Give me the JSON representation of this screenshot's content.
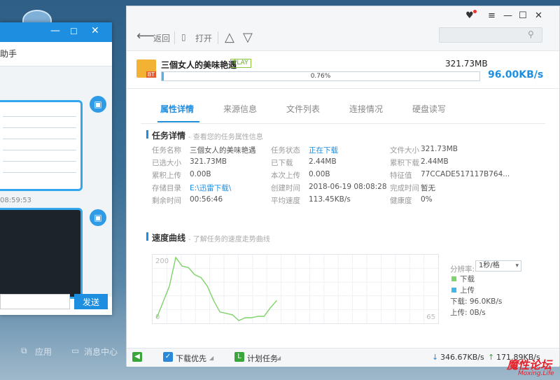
{
  "desktop": {
    "chat_title_fragment": "助手",
    "chat_time": "08:59:53",
    "send_label": "发送",
    "bottom_apps": "应用",
    "bottom_msg": "消息中心"
  },
  "window_controls": {
    "skin": "♥",
    "menu": "≡",
    "minimize": "—",
    "maximize": "☐",
    "close": "✕"
  },
  "toolbar": {
    "back_label": "返回",
    "open_label": "打开",
    "search_placeholder": ""
  },
  "task": {
    "name": "三個女人的美味艳遇",
    "play_label": "PLAY",
    "badge": "BT",
    "size": "321.73MB",
    "progress_percent": 0.76,
    "progress_text": "0.76%",
    "speed": "96.00KB/s"
  },
  "tabs": [
    "属性详情",
    "来源信息",
    "文件列表",
    "连接情况",
    "硬盘读写"
  ],
  "task_info": {
    "title": "任务详情",
    "subtitle": "- 查看您的任务属性信息",
    "rows": [
      [
        [
          "任务名称",
          "三個女人的美味艳遇",
          false
        ],
        [
          "任务状态",
          "正在下载",
          true
        ],
        [
          "文件大小",
          "321.73MB",
          false
        ]
      ],
      [
        [
          "已选大小",
          "321.73MB",
          false
        ],
        [
          "已下载",
          "2.44MB",
          false
        ],
        [
          "累积下载",
          "2.44MB",
          false
        ]
      ],
      [
        [
          "累积上传",
          "0.00B",
          false
        ],
        [
          "本次上传",
          "0.00B",
          false
        ],
        [
          "特征值",
          "77CCADE517117B764...",
          false
        ]
      ],
      [
        [
          "存储目录",
          "E:\\迅雷下载\\",
          true
        ],
        [
          "创建时间",
          "2018-06-19 08:08:28",
          false
        ],
        [
          "完成时间",
          "暂无",
          false
        ]
      ],
      [
        [
          "剩余时间",
          "00:56:46",
          false
        ],
        [
          "平均速度",
          "113.45KB/s",
          false
        ],
        [
          "健康度",
          "0%",
          false
        ]
      ]
    ]
  },
  "speed_curve": {
    "title": "速度曲线",
    "subtitle": "- 了解任务的速度走势曲线",
    "resolution_label": "分辨率:",
    "resolution_value": "1秒/格",
    "legend_download": "下载",
    "legend_upload": "上传",
    "download_speed": "下载:   96.0KB/s",
    "upload_speed": "上传:   0B/s",
    "colors": {
      "download": "#7ed36a",
      "upload": "#42b8ea"
    }
  },
  "chart_data": {
    "type": "line",
    "title": "",
    "xlabel": "",
    "ylabel": "",
    "y_tick_top": "200",
    "y_tick_bottom": "0",
    "x_tick_right": "65",
    "ylim": [
      0,
      200
    ],
    "series": [
      {
        "name": "下载",
        "values": [
          0,
          55,
          110,
          210,
          180,
          175,
          150,
          140,
          110,
          60,
          20,
          15,
          10,
          -10,
          0,
          0,
          5,
          5,
          35,
          60
        ]
      }
    ]
  },
  "status_bar": {
    "priority_label": "下载优先",
    "plan_label": "计划任务",
    "down_speed": "346.67KB/s",
    "up_speed": "171.89KB/s"
  },
  "watermark": {
    "text": "魔性论坛",
    "sub": "Moxing.Life"
  }
}
